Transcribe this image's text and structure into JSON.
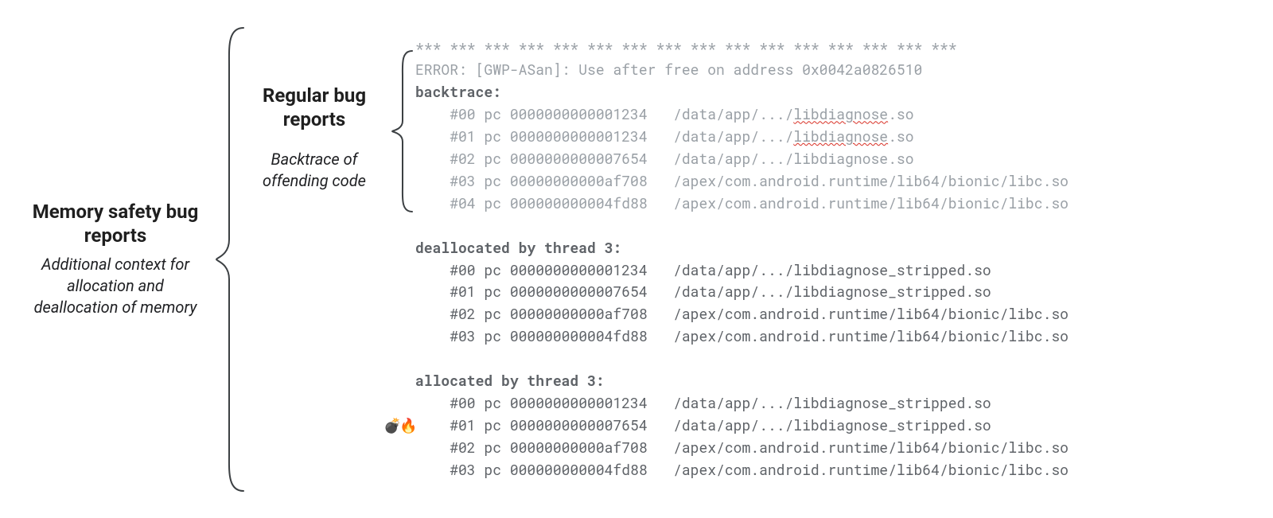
{
  "labels": {
    "outer": {
      "title": "Memory safety bug reports",
      "subtitle": "Additional context for allocation and deallocation of memory"
    },
    "inner": {
      "title": "Regular bug reports",
      "subtitle": "Backtrace of offending code"
    }
  },
  "code": {
    "stars": "*** *** *** *** *** *** *** *** *** *** *** *** *** *** *** ***",
    "error": "ERROR: [GWP-ASan]: Use after free on address 0x0042a0826510",
    "backtrace_label": "backtrace:",
    "backtrace": [
      {
        "idx": "#00",
        "pc": "pc 0000000000001234",
        "path_prefix": "/data/app/.../",
        "lib": "libdiagnose",
        "ext": ".so",
        "wavy": true
      },
      {
        "idx": "#01",
        "pc": "pc 0000000000001234",
        "path_prefix": "/data/app/.../",
        "lib": "libdiagnose",
        "ext": ".so",
        "wavy": true
      },
      {
        "idx": "#02",
        "pc": "pc 0000000000007654",
        "path_prefix": "/data/app/.../",
        "lib": "libdiagnose",
        "ext": ".so",
        "wavy": false
      },
      {
        "idx": "#03",
        "pc": "pc 00000000000af708",
        "path_full": "/apex/com.android.runtime/lib64/bionic/libc.so"
      },
      {
        "idx": "#04",
        "pc": "pc 000000000004fd88",
        "path_full": "/apex/com.android.runtime/lib64/bionic/libc.so"
      }
    ],
    "dealloc_label": "deallocated by thread 3:",
    "dealloc": [
      {
        "idx": "#00",
        "pc": "pc 0000000000001234",
        "path": "/data/app/.../libdiagnose_stripped.so"
      },
      {
        "idx": "#01",
        "pc": "pc 0000000000007654",
        "path": "/data/app/.../libdiagnose_stripped.so"
      },
      {
        "idx": "#02",
        "pc": "pc 00000000000af708",
        "path": "/apex/com.android.runtime/lib64/bionic/libc.so"
      },
      {
        "idx": "#03",
        "pc": "pc 000000000004fd88",
        "path": "/apex/com.android.runtime/lib64/bionic/libc.so"
      }
    ],
    "alloc_label": "allocated by thread 3:",
    "alloc": [
      {
        "idx": "#00",
        "pc": "pc 0000000000001234",
        "path": "/data/app/.../libdiagnose_stripped.so"
      },
      {
        "idx": "#01",
        "pc": "pc 0000000000007654",
        "path": "/data/app/.../libdiagnose_stripped.so",
        "emoji": "💣🔥"
      },
      {
        "idx": "#02",
        "pc": "pc 00000000000af708",
        "path": "/apex/com.android.runtime/lib64/bionic/libc.so"
      },
      {
        "idx": "#03",
        "pc": "pc 000000000004fd88",
        "path": "/apex/com.android.runtime/lib64/bionic/libc.so"
      }
    ]
  }
}
